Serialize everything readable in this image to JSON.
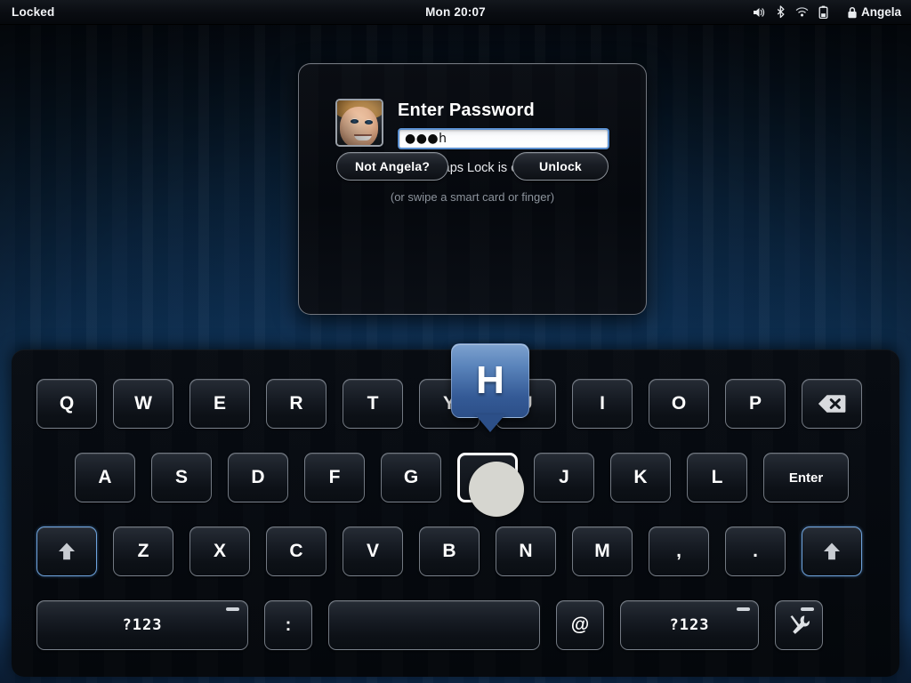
{
  "topbar": {
    "status_label": "Locked",
    "clock": "Mon 20:07",
    "tray": [
      {
        "name": "volume-icon",
        "label": "volume"
      },
      {
        "name": "bluetooth-icon",
        "label": "bluetooth"
      },
      {
        "name": "wifi-icon",
        "label": "wifi"
      },
      {
        "name": "battery-icon",
        "label": "battery"
      }
    ],
    "user_name": "Angela",
    "user_lock_icon": "lock-icon"
  },
  "dialog": {
    "title": "Enter Password",
    "avatar_alt": "Angela",
    "password_value": "●●● h",
    "password_masked_display": "●●●h",
    "password_placeholder": "",
    "caps_lock_glyph": "♣",
    "caps_lock_text": "Caps Lock is on",
    "swipe_hint": "(or swipe a smart card or finger)",
    "not_user_label": "Not Angela?",
    "unlock_label": "Unlock"
  },
  "keyboard": {
    "popup_key": "H",
    "pressed_key": "H",
    "rows": [
      {
        "id": "row1",
        "keys": [
          {
            "label": "Q",
            "name": "key-q",
            "cls": ""
          },
          {
            "label": "W",
            "name": "key-w",
            "cls": ""
          },
          {
            "label": "E",
            "name": "key-e",
            "cls": ""
          },
          {
            "label": "R",
            "name": "key-r",
            "cls": ""
          },
          {
            "label": "T",
            "name": "key-t",
            "cls": ""
          },
          {
            "label": "Y",
            "name": "key-y",
            "cls": ""
          },
          {
            "label": "U",
            "name": "key-u",
            "cls": ""
          },
          {
            "label": "I",
            "name": "key-i",
            "cls": ""
          },
          {
            "label": "O",
            "name": "key-o",
            "cls": ""
          },
          {
            "label": "P",
            "name": "key-p",
            "cls": ""
          },
          {
            "label": "",
            "name": "key-backspace",
            "cls": "wide-bksp",
            "icon": "backspace-icon"
          }
        ]
      },
      {
        "id": "row2",
        "keys": [
          {
            "label": "A",
            "name": "key-a",
            "cls": ""
          },
          {
            "label": "S",
            "name": "key-s",
            "cls": ""
          },
          {
            "label": "D",
            "name": "key-d",
            "cls": ""
          },
          {
            "label": "F",
            "name": "key-f",
            "cls": ""
          },
          {
            "label": "G",
            "name": "key-g",
            "cls": ""
          },
          {
            "label": "H",
            "name": "key-h",
            "cls": "pressed"
          },
          {
            "label": "J",
            "name": "key-j",
            "cls": ""
          },
          {
            "label": "K",
            "name": "key-k",
            "cls": ""
          },
          {
            "label": "L",
            "name": "key-l",
            "cls": ""
          },
          {
            "label": "Enter",
            "name": "key-enter",
            "cls": "enter"
          }
        ]
      },
      {
        "id": "row3",
        "keys": [
          {
            "label": "",
            "name": "key-shift-left",
            "cls": "shift",
            "icon": "shift-arrow-icon"
          },
          {
            "label": "Z",
            "name": "key-z",
            "cls": ""
          },
          {
            "label": "X",
            "name": "key-x",
            "cls": ""
          },
          {
            "label": "C",
            "name": "key-c",
            "cls": ""
          },
          {
            "label": "V",
            "name": "key-v",
            "cls": ""
          },
          {
            "label": "B",
            "name": "key-b",
            "cls": ""
          },
          {
            "label": "N",
            "name": "key-n",
            "cls": ""
          },
          {
            "label": "M",
            "name": "key-m",
            "cls": ""
          },
          {
            "label": ",",
            "name": "key-comma",
            "cls": ""
          },
          {
            "label": ".",
            "name": "key-period",
            "cls": ""
          },
          {
            "label": "",
            "name": "key-shift-right",
            "cls": "shift",
            "icon": "shift-arrow-icon"
          }
        ]
      },
      {
        "id": "row4",
        "keys": [
          {
            "label": "?123",
            "name": "key-symbols-left",
            "cls": "num",
            "dash": true
          },
          {
            "label": ":",
            "name": "key-colon",
            "cls": "colon"
          },
          {
            "label": "",
            "name": "key-space",
            "cls": "space"
          },
          {
            "label": "@",
            "name": "key-at",
            "cls": "at"
          },
          {
            "label": "?123",
            "name": "key-symbols-right",
            "cls": "num2",
            "dash": true
          },
          {
            "label": "",
            "name": "key-preferences",
            "cls": "tools",
            "icon": "tools-icon",
            "dash": true
          }
        ]
      }
    ]
  },
  "colors": {
    "accent_blue": "#3a6bb0",
    "key_border": "#b0b8c4",
    "shift_active_border": "#6ea3dd",
    "panel_bg": "#060a10",
    "wallpaper_deep": "#04080f",
    "wallpaper_mid": "#16457a",
    "input_focus_border": "#5a8fd0",
    "touch_dot": "#d6d6d0"
  }
}
